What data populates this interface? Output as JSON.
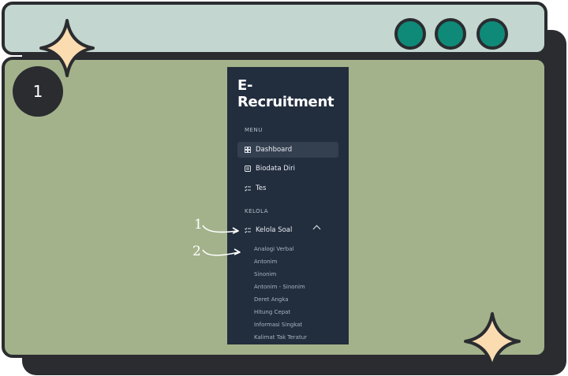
{
  "badge": "1",
  "sidebar": {
    "brand": "E-Recruitment",
    "menu_header": "MENU",
    "menu_items": [
      {
        "label": "Dashboard",
        "icon": "grid-icon"
      },
      {
        "label": "Biodata Diri",
        "icon": "id-card-icon"
      },
      {
        "label": "Tes",
        "icon": "checklist-icon"
      }
    ],
    "kelola_header": "KELOLA",
    "kelola_item": {
      "label": "Kelola Soal",
      "icon": "checklist-icon"
    },
    "sub_items": [
      "Analogi Verbal",
      "Antonim",
      "Sinonim",
      "Antonim - Sinonim",
      "Deret Angka",
      "Hitung Cepat",
      "Informasi Singkat",
      "Kalimat Tak Teratur"
    ]
  },
  "annotations": [
    "1",
    "2"
  ],
  "colors": {
    "titlebar": "#c3d6cf",
    "panel": "#a3b28a",
    "sidebar": "#222d3d",
    "dots": "#0f8a78",
    "sparkle": "#fbdcb0"
  }
}
